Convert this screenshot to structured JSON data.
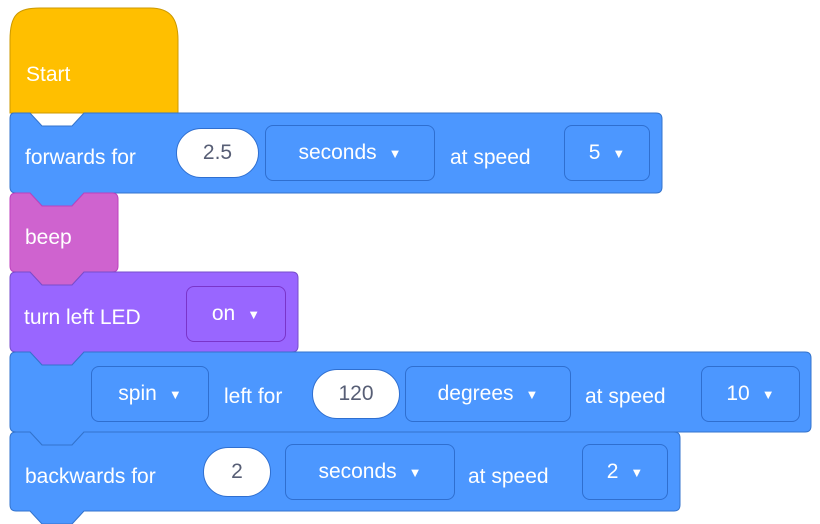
{
  "start_block": {
    "label": "Start"
  },
  "forwards_block": {
    "label": "forwards for",
    "value": "2.5",
    "unit": "seconds",
    "speed_label": "at speed",
    "speed": "5"
  },
  "beep_block": {
    "label": "beep"
  },
  "led_block": {
    "label": "turn left LED",
    "state": "on"
  },
  "spin_block": {
    "direction": "spin",
    "label": "left for",
    "value": "120",
    "unit": "degrees",
    "speed_label": "at speed",
    "speed": "10"
  },
  "backwards_block": {
    "label": "backwards for",
    "value": "2",
    "unit": "seconds",
    "speed_label": "at speed",
    "speed": "2"
  },
  "icons": {
    "dropdown": "caret-down-icon"
  },
  "colors": {
    "event_yellow": "#ffbf00",
    "motion_blue": "#4c97ff",
    "sound_magenta": "#cf63cf",
    "looks_purple": "#9966ff"
  }
}
